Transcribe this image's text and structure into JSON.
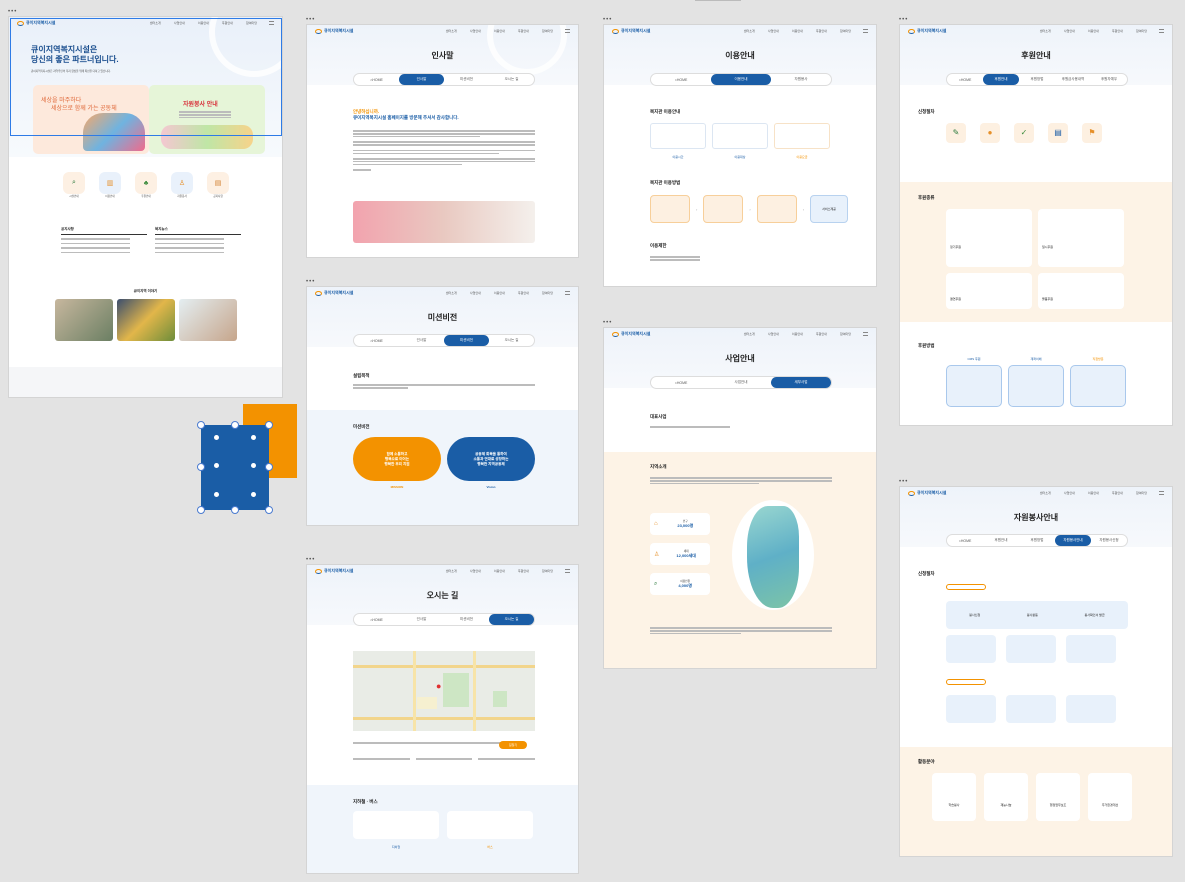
{
  "site_name": "큐이지역복지시설",
  "nav": [
    "센터소개",
    "사업안내",
    "이용안내",
    "후원안내",
    "참여마당"
  ],
  "home": {
    "hero_line1": "큐이지역복지시설은",
    "hero_line2": "당신의 좋은 파트너입니다.",
    "hero_sub": "큐이지역복지시설은 지역주민의 복지 향상을 위해 최선을 다하고 있습니다.",
    "left_card_line1": "세상을 마주하다",
    "left_card_line2": "세상으로 함께 가는 공동체",
    "right_card_title": "자원봉사 안내",
    "quick": [
      "시설안내",
      "이용안내",
      "후원안내",
      "자원봉사",
      "공지사항"
    ],
    "notice_title": "공지사항",
    "news_title": "복지뉴스",
    "story_title": "큐이지역 이야기"
  },
  "greeting": {
    "title": "인사말",
    "tabs": [
      "HOME",
      "인사말",
      "미션비전",
      "오시는 길"
    ],
    "heading1": "안녕하십니까.",
    "heading2": "큐이지역복지시설 홈페이지를 방문해 주셔서 감사합니다."
  },
  "mission": {
    "title": "미션비전",
    "tabs": [
      "HOME",
      "인사말",
      "미션비전",
      "오시는 길"
    ],
    "sec1": "설립목적",
    "sec2": "미션비전",
    "pill1": "함께 소통하고\n행복으로 이어는\n행복한 우리 지원",
    "pill2": "공동체 회복을 통하여\n소통과 연대로 성장하는\n행복한 지역공동체",
    "label1": "MISSION",
    "label2": "Vision"
  },
  "directions": {
    "title": "오시는 길",
    "tabs": [
      "HOME",
      "인사말",
      "미션비전",
      "오시는 길"
    ],
    "sec2": "지하철 · 버스",
    "btn": "길찾기",
    "bottom1": "지하철",
    "bottom2": "버스"
  },
  "usage": {
    "title": "이용안내",
    "tabs": [
      "HOME",
      "이용안내",
      "자원봉사"
    ],
    "sec1": "복지관 이용안내",
    "sec2": "복지관 이용방법",
    "sec3": "이용제한",
    "labels": [
      "이용시간",
      "이용대상",
      "이용요금"
    ],
    "step4": "서비스제공"
  },
  "business": {
    "title": "사업안내",
    "tabs": [
      "HOME",
      "사업안내",
      "세부사업"
    ],
    "sec1": "대표사업",
    "sec2": "지역소개",
    "stats": [
      {
        "label": "인구",
        "value": "23,000명"
      },
      {
        "label": "세대",
        "value": "12,000세대"
      },
      {
        "label": "이용인원",
        "value": "4,000명"
      }
    ]
  },
  "support": {
    "title": "후원안내",
    "tabs": [
      "HOME",
      "후원안내",
      "후원방법",
      "후원금사용내역",
      "후원자예우"
    ],
    "sec1": "신청절차",
    "sec2": "후원종류",
    "sec3": "후원방법",
    "methods": [
      "CMS 후원",
      "계좌이체",
      "직접방문"
    ],
    "kinds": [
      "정기후원",
      "일시후원",
      "결연후원",
      "물품후원"
    ]
  },
  "volunteer": {
    "title": "자원봉사안내",
    "tabs": [
      "HOME",
      "후원안내",
      "후원방법",
      "자원봉사안내",
      "자원봉사신청"
    ],
    "sec1": "신청절차",
    "sec2": "활동분야",
    "steps": [
      "봉사신청",
      "봉사활동",
      "봉사확인서 발급"
    ],
    "fields": [
      "학습봉사",
      "재능나눔",
      "행정업무보조",
      "주거환경개선"
    ]
  },
  "colors": {
    "primary": "#1a5da6",
    "accent": "#f39200",
    "soft": "#fdf3e6"
  }
}
